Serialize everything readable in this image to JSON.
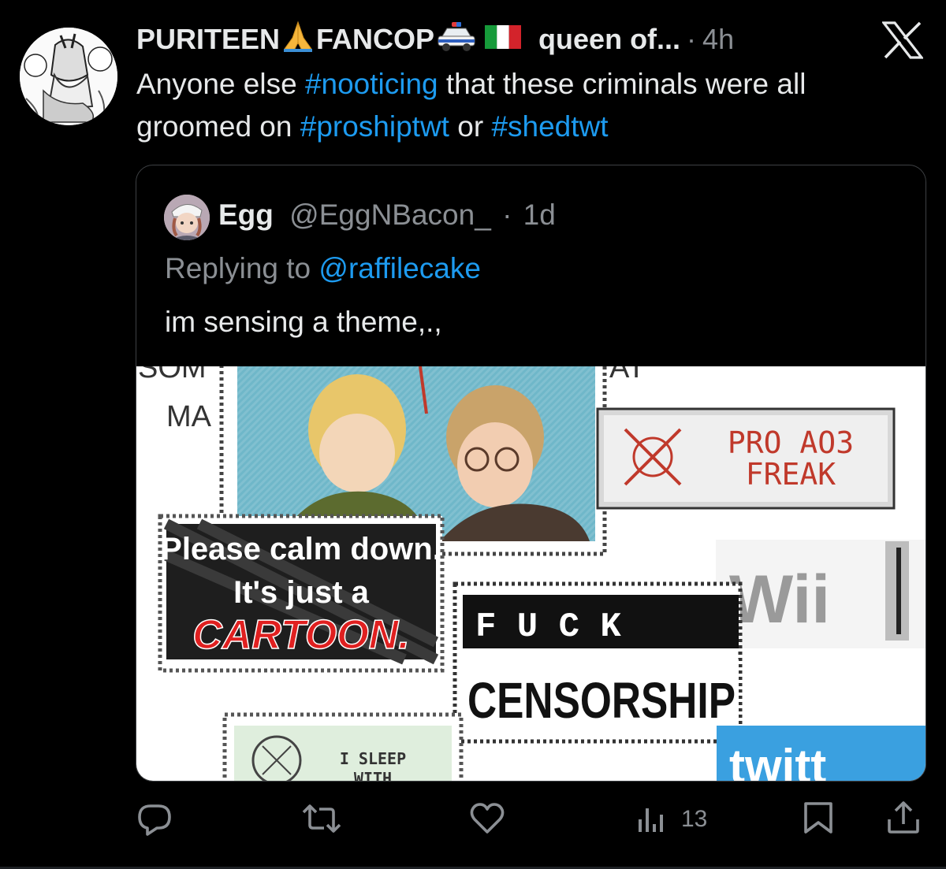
{
  "tweet": {
    "display_name": "PURITEEN",
    "display_name_2": "FANCOP",
    "handle_label": "queen of...",
    "separator": "·",
    "time": "4h",
    "text": {
      "t1": "Anyone else ",
      "tag1": "#nooticing",
      "t2": " that these criminals were all groomed on ",
      "tag2": "#proshiptwt",
      "t3": " or ",
      "tag3": "#shedtwt"
    }
  },
  "quote": {
    "name": "Egg",
    "handle": "@EggNBacon_",
    "separator": "·",
    "time": "1d",
    "replying_prefix": "Replying to ",
    "replying_to": "@raffilecake",
    "text": "im sensing a theme,.,",
    "media": {
      "som_fragment": "SOM",
      "ma_text": "MA",
      "at_fragment": "AT",
      "stamp_calm_line1": "Please calm down.",
      "stamp_calm_line2": "It's just a",
      "stamp_calm_line3": "CARTOON.",
      "stamp_ao3_line1": "PRO AO3",
      "stamp_ao3_line2": "FREAK",
      "stamp_wii": "Wii",
      "stamp_fuck": "F U C K",
      "stamp_censorship": "CENSORSHIP",
      "stamp_sleep_line1": "I SLEEP",
      "stamp_sleep_line2": "WITH",
      "twitter_fragment": "twitt"
    }
  },
  "actions": {
    "views_count": "13"
  },
  "icons": {
    "avatar": "manga-avatar",
    "x_logo": "x-logo-icon",
    "reply": "reply-icon",
    "retweet": "retweet-icon",
    "like": "heart-icon",
    "views": "views-icon",
    "bookmark": "bookmark-icon",
    "share": "share-icon"
  },
  "colors": {
    "background": "#000000",
    "text": "#e7e9ea",
    "secondary": "#8b8f94",
    "link": "#1d9bf0",
    "border": "#3e4144"
  }
}
